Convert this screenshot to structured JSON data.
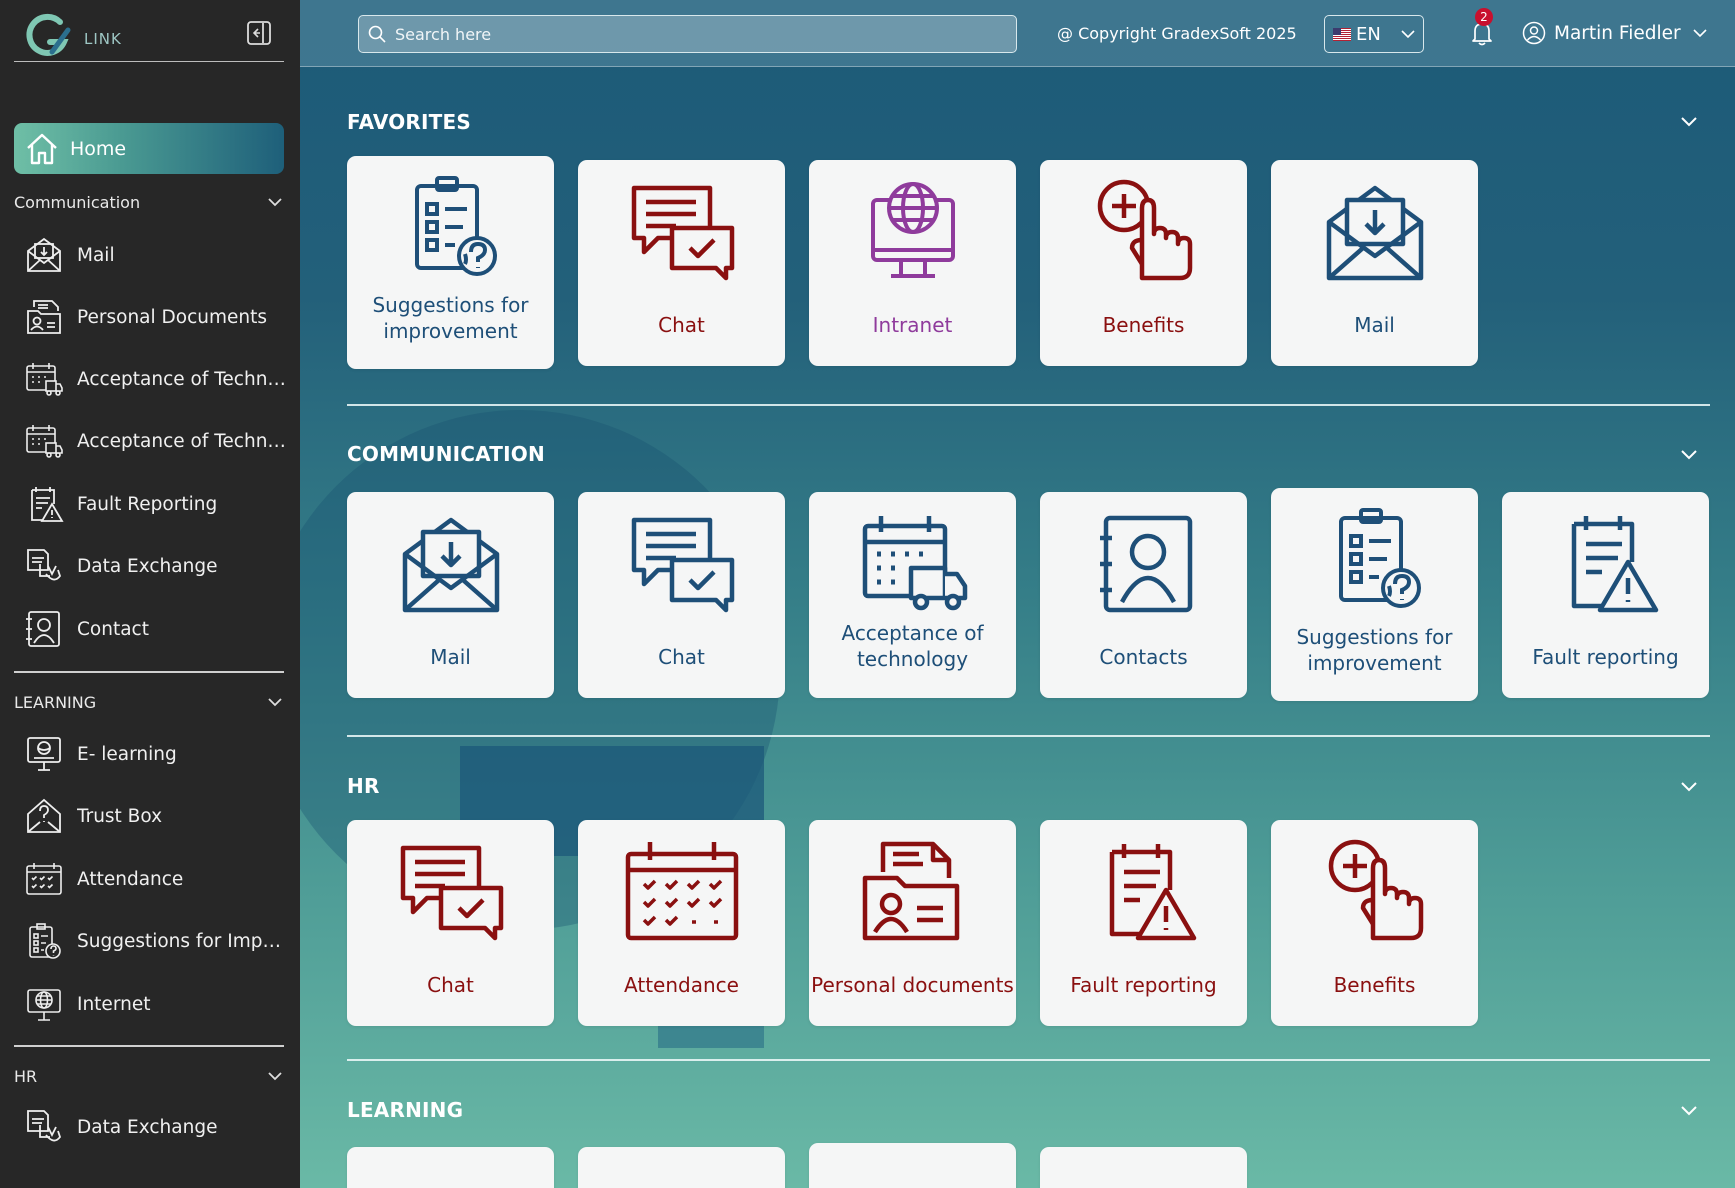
{
  "sidebar": {
    "logo_text": "LINK",
    "home_label": "Home",
    "sections": [
      {
        "label": "Communication"
      },
      {
        "label": "LEARNING"
      },
      {
        "label": "HR"
      }
    ],
    "communication_items": [
      {
        "label": "Mail",
        "icon": "mail-icon"
      },
      {
        "label": "Personal Documents",
        "icon": "personal-documents-icon"
      },
      {
        "label": "Acceptance of Techno...",
        "icon": "delivery-calendar-icon"
      },
      {
        "label": "Acceptance of Techno...",
        "icon": "delivery-calendar-icon"
      },
      {
        "label": "Fault Reporting",
        "icon": "fault-report-icon"
      },
      {
        "label": "Data Exchange",
        "icon": "data-exchange-icon"
      },
      {
        "label": "Contact",
        "icon": "contact-icon"
      }
    ],
    "learning_items": [
      {
        "label": "E- learning",
        "icon": "e-learning-icon"
      },
      {
        "label": "Trust Box",
        "icon": "trust-box-icon"
      },
      {
        "label": "Attendance",
        "icon": "attendance-icon"
      },
      {
        "label": "Suggestions for Impro...",
        "icon": "suggestions-icon"
      },
      {
        "label": "Internet",
        "icon": "internet-icon"
      }
    ],
    "hr_items": [
      {
        "label": "Data Exchange",
        "icon": "data-exchange-icon"
      }
    ]
  },
  "topbar": {
    "search_placeholder": "Search here",
    "copyright": "@ Copyright GradexSoft 2025",
    "language": "EN",
    "notification_count": "2",
    "user_name": "Martin Fiedler"
  },
  "sections": {
    "favorites": {
      "title": "FAVORITES",
      "cards": [
        {
          "label": "Suggestions for improvement",
          "icon": "suggestions-icon",
          "color": "#1e4f78"
        },
        {
          "label": "Chat",
          "icon": "chat-icon",
          "color": "#8a1010"
        },
        {
          "label": "Intranet",
          "icon": "intranet-icon",
          "color": "#8f3b9c"
        },
        {
          "label": "Benefits",
          "icon": "benefits-icon",
          "color": "#8a1010"
        },
        {
          "label": "Mail",
          "icon": "mail-icon",
          "color": "#1e4f78"
        }
      ]
    },
    "communication": {
      "title": "COMMUNICATION",
      "cards": [
        {
          "label": "Mail",
          "icon": "mail-icon",
          "color": "#1e4f78"
        },
        {
          "label": "Chat",
          "icon": "chat-icon",
          "color": "#1e4f78"
        },
        {
          "label": "Acceptance of technology",
          "icon": "delivery-calendar-icon",
          "color": "#1e4f78"
        },
        {
          "label": "Contacts",
          "icon": "contact-icon",
          "color": "#1e4f78"
        },
        {
          "label": "Suggestions for improvement",
          "icon": "suggestions-icon",
          "color": "#1e4f78"
        },
        {
          "label": "Fault reporting",
          "icon": "fault-report-icon",
          "color": "#1e4f78"
        }
      ]
    },
    "hr": {
      "title": "HR",
      "cards": [
        {
          "label": "Chat",
          "icon": "chat-icon",
          "color": "#8a1010"
        },
        {
          "label": "Attendance",
          "icon": "attendance-icon",
          "color": "#8a1010"
        },
        {
          "label": "Personal documents",
          "icon": "personal-documents-icon",
          "color": "#8a1010"
        },
        {
          "label": "Fault reporting",
          "icon": "fault-report-icon",
          "color": "#8a1010"
        },
        {
          "label": "Benefits",
          "icon": "benefits-icon",
          "color": "#8a1010"
        }
      ]
    },
    "learning": {
      "title": "LEARNING"
    }
  },
  "colors": {
    "sidebar_bg": "#272727",
    "icon_blue": "#1e4f78",
    "icon_red": "#8a1010",
    "icon_purple": "#8f3b9c",
    "badge_red": "#c8102e"
  }
}
